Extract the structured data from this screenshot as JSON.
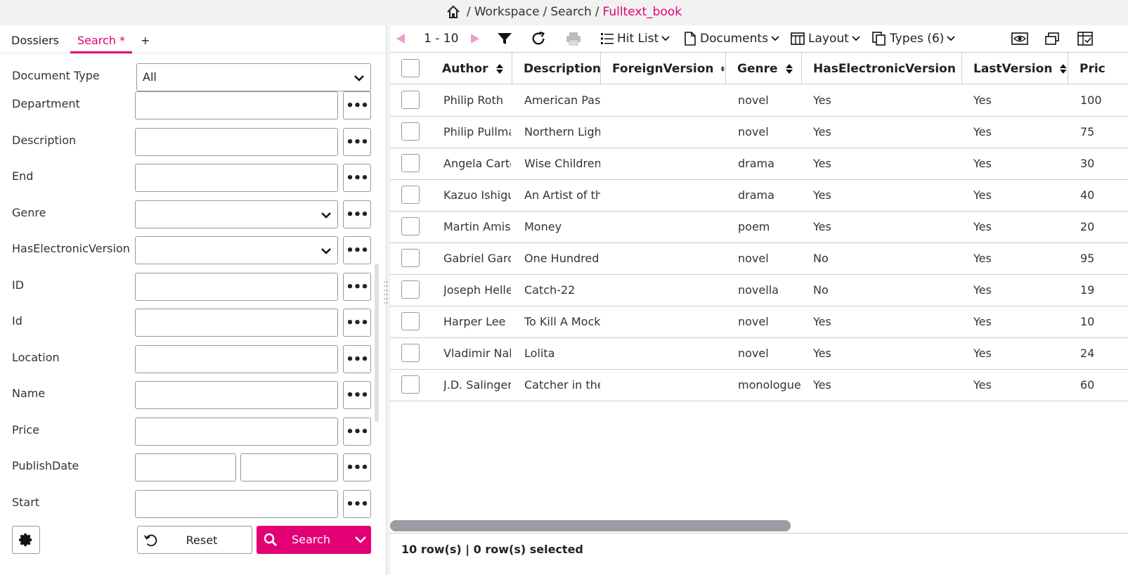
{
  "breadcrumb": {
    "items": [
      "Workspace",
      "Search"
    ],
    "active": "Fulltext_book"
  },
  "left": {
    "tabs": [
      {
        "label": "Dossiers"
      },
      {
        "label": "Search *"
      },
      {
        "label": "+"
      }
    ],
    "fields": {
      "doctype": {
        "label": "Document Type",
        "value": "All"
      },
      "department": {
        "label": "Department"
      },
      "description": {
        "label": "Description"
      },
      "end": {
        "label": "End"
      },
      "genre": {
        "label": "Genre"
      },
      "haselectronic": {
        "label": "HasElectronicVersion"
      },
      "id_upper": {
        "label": "ID"
      },
      "id_lower": {
        "label": "Id"
      },
      "location": {
        "label": "Location"
      },
      "name": {
        "label": "Name"
      },
      "price": {
        "label": "Price"
      },
      "publishdate": {
        "label": "PublishDate"
      },
      "start": {
        "label": "Start"
      }
    },
    "more_glyph": "•••",
    "reset_label": "Reset",
    "search_label": "Search"
  },
  "toolbar": {
    "range": "1 - 10",
    "hitlist": "Hit List",
    "documents": "Documents",
    "layout": "Layout",
    "types": "Types (6)"
  },
  "grid": {
    "columns": [
      "Author",
      "Description",
      "ForeignVersion",
      "Genre",
      "HasElectronicVersion",
      "LastVersion",
      "Pric"
    ],
    "rows": [
      {
        "author": "Philip Roth",
        "description": "American Past",
        "foreign": "",
        "genre": "novel",
        "electronic": "Yes",
        "last": "Yes",
        "price": "100"
      },
      {
        "author": "Philip Pullma",
        "description": "Northern Light",
        "foreign": "",
        "genre": "novel",
        "electronic": "Yes",
        "last": "Yes",
        "price": "75"
      },
      {
        "author": "Angela Carte",
        "description": "Wise Children",
        "foreign": "",
        "genre": "drama",
        "electronic": "Yes",
        "last": "Yes",
        "price": "30"
      },
      {
        "author": "Kazuo Ishigu",
        "description": "An Artist of the",
        "foreign": "",
        "genre": "drama",
        "electronic": "Yes",
        "last": "Yes",
        "price": "40"
      },
      {
        "author": "Martin Amis",
        "description": "Money",
        "foreign": "",
        "genre": "poem",
        "electronic": "Yes",
        "last": "Yes",
        "price": "20"
      },
      {
        "author": "Gabriel Garci",
        "description": "One Hundred Y",
        "foreign": "",
        "genre": "novel",
        "electronic": "No",
        "last": "Yes",
        "price": "95"
      },
      {
        "author": "Joseph Helle",
        "description": "Catch-22",
        "foreign": "",
        "genre": "novella",
        "electronic": "No",
        "last": "Yes",
        "price": "19"
      },
      {
        "author": "Harper Lee",
        "description": "To Kill A Mocki",
        "foreign": "",
        "genre": "novel",
        "electronic": "Yes",
        "last": "Yes",
        "price": "10"
      },
      {
        "author": "Vladimir Nab",
        "description": "Lolita",
        "foreign": "",
        "genre": "novel",
        "electronic": "Yes",
        "last": "Yes",
        "price": "24"
      },
      {
        "author": "J.D. Salinger",
        "description": "Catcher in the",
        "foreign": "",
        "genre": "monologue",
        "electronic": "Yes",
        "last": "Yes",
        "price": "60"
      }
    ]
  },
  "status": "10 row(s) | 0 row(s) selected",
  "colors": {
    "accent": "#e20074",
    "disabled_accent": "#f29ccb"
  }
}
